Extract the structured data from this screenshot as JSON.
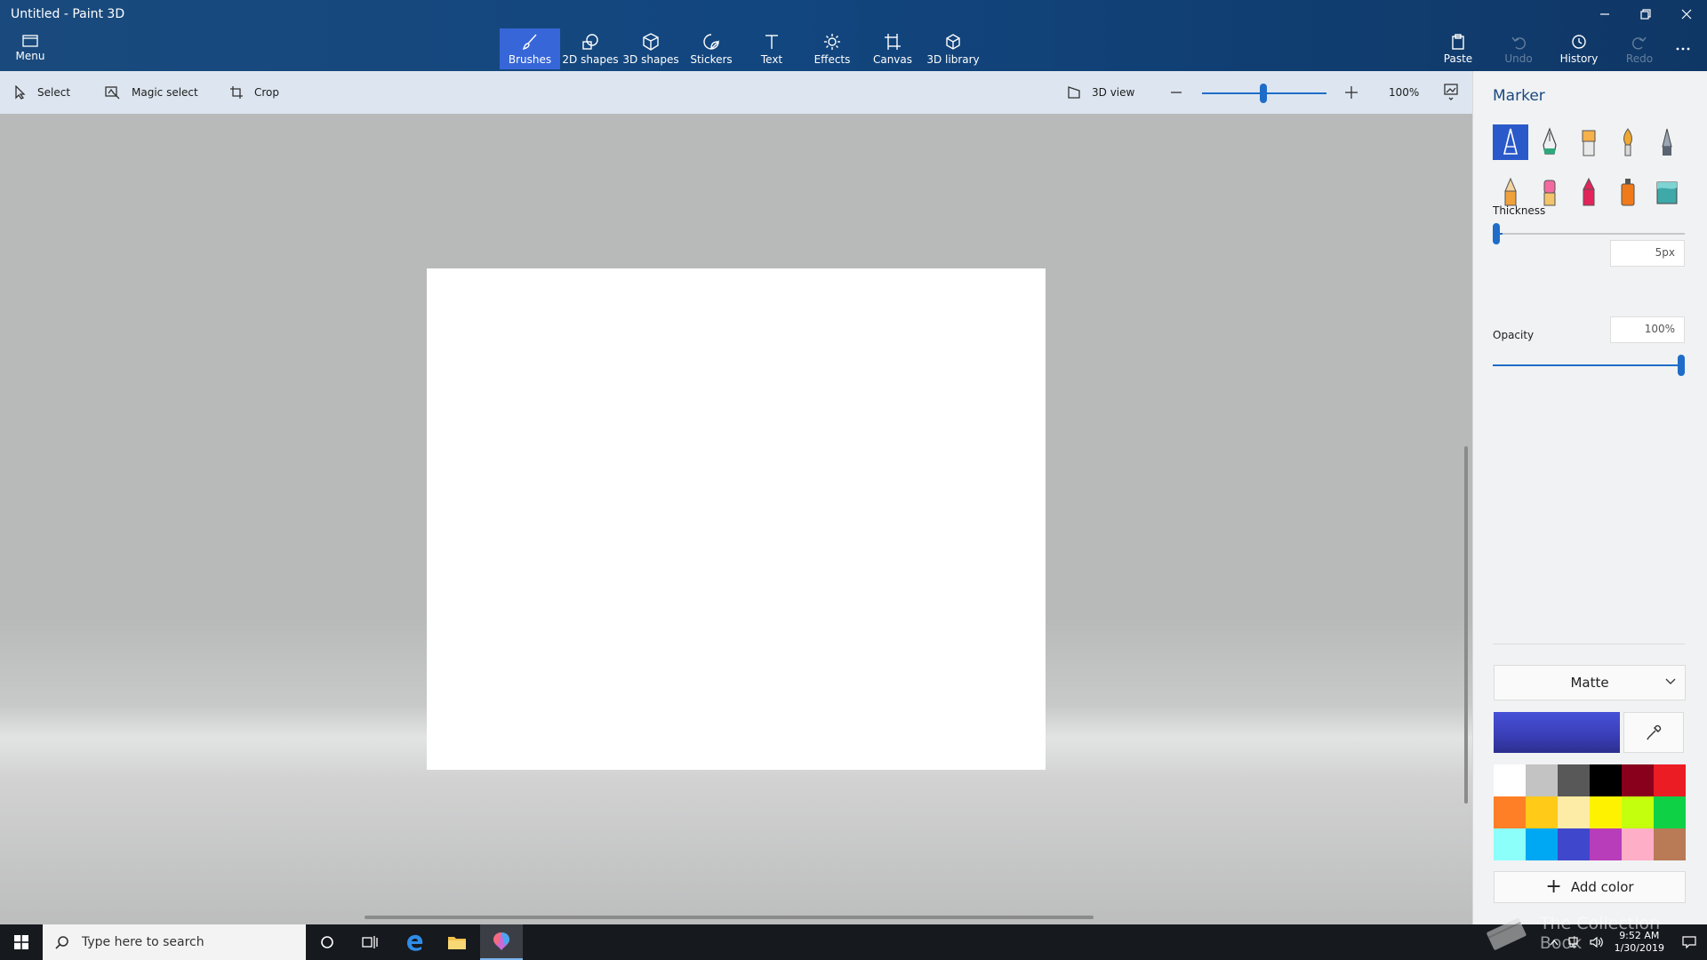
{
  "window": {
    "title": "Untitled - Paint 3D"
  },
  "ribbon": {
    "menu_label": "Menu",
    "tools": [
      {
        "label": "Brushes",
        "icon": "brush-icon",
        "active": true
      },
      {
        "label": "2D shapes",
        "icon": "2d-shapes-icon"
      },
      {
        "label": "3D shapes",
        "icon": "3d-shapes-icon"
      },
      {
        "label": "Stickers",
        "icon": "stickers-icon"
      },
      {
        "label": "Text",
        "icon": "text-icon"
      },
      {
        "label": "Effects",
        "icon": "effects-icon"
      },
      {
        "label": "Canvas",
        "icon": "canvas-icon"
      },
      {
        "label": "3D library",
        "icon": "3d-library-icon"
      }
    ],
    "paste_label": "Paste",
    "undo_label": "Undo",
    "history_label": "History",
    "redo_label": "Redo"
  },
  "subbar": {
    "select_label": "Select",
    "magic_select_label": "Magic select",
    "crop_label": "Crop",
    "view_3d_label": "3D view",
    "zoom_level": "100%"
  },
  "panel": {
    "title": "Marker",
    "brushes": [
      {
        "name": "marker",
        "active": true
      },
      {
        "name": "calligraphy-pen"
      },
      {
        "name": "oil-brush"
      },
      {
        "name": "watercolor"
      },
      {
        "name": "pixel-pen"
      },
      {
        "name": "pencil"
      },
      {
        "name": "eraser"
      },
      {
        "name": "crayon"
      },
      {
        "name": "spray-can"
      },
      {
        "name": "fill"
      }
    ],
    "thickness_label": "Thickness",
    "thickness_value": "5px",
    "opacity_label": "Opacity",
    "opacity_value": "100%",
    "finish_label": "Matte",
    "add_color_label": "Add color",
    "current_color": "#3b3fb9",
    "palette": [
      "#ffffff",
      "#c3c3c3",
      "#585858",
      "#000000",
      "#88001b",
      "#ec1c24",
      "#ff7f27",
      "#ffca18",
      "#fdeca6",
      "#fff200",
      "#c4ff0e",
      "#0ed145",
      "#8cfffb",
      "#00a8f3",
      "#3f48cc",
      "#b83dba",
      "#ffaec8",
      "#b97a56"
    ]
  },
  "taskbar": {
    "search_placeholder": "Type here to search",
    "time": "9:52 AM",
    "date": "1/30/2019"
  },
  "watermark": "The Collection Book"
}
